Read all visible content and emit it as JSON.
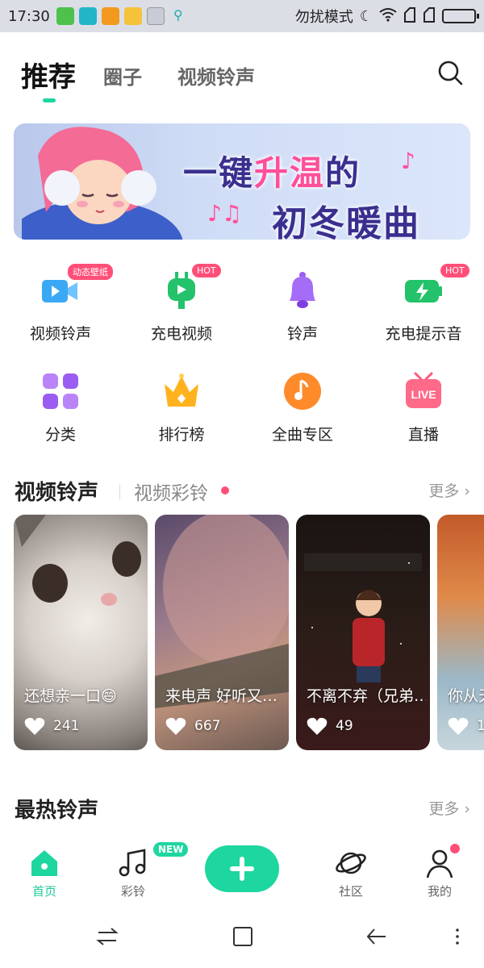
{
  "status_bar": {
    "time": "17:30",
    "dnd_text": "勿扰模式"
  },
  "top_tabs": [
    {
      "label": "推荐",
      "active": true
    },
    {
      "label": "圈子",
      "active": false
    },
    {
      "label": "视频铃声",
      "active": false
    }
  ],
  "banner": {
    "line1_a": "一键",
    "line1_pink": "升温",
    "line1_b": "的",
    "line2": "初冬暖曲"
  },
  "grid_items": [
    {
      "label": "视频铃声",
      "badge": "动态壁纸",
      "icon": "video-camera-icon",
      "color": "#2f9cf0"
    },
    {
      "label": "充电视频",
      "badge": "HOT",
      "icon": "charging-video-icon",
      "color": "#23c26b"
    },
    {
      "label": "铃声",
      "badge": "",
      "icon": "bell-icon",
      "color": "#9b5cf2"
    },
    {
      "label": "充电提示音",
      "badge": "HOT",
      "icon": "battery-bolt-icon",
      "color": "#23c26b"
    },
    {
      "label": "分类",
      "badge": "",
      "icon": "category-grid-icon",
      "color": "#a36cf5"
    },
    {
      "label": "排行榜",
      "badge": "",
      "icon": "crown-icon",
      "color": "#ffb21d"
    },
    {
      "label": "全曲专区",
      "badge": "",
      "icon": "music-disc-icon",
      "color": "#ff8a2a"
    },
    {
      "label": "直播",
      "badge": "",
      "icon": "live-tv-icon",
      "color": "#ff5a7a"
    }
  ],
  "video_section": {
    "title": "视频铃声",
    "subtitle": "视频彩铃",
    "more": "更多 ›"
  },
  "video_cards": [
    {
      "title": "还想亲一口😄",
      "likes": "241"
    },
    {
      "title": "来电声 好听又…",
      "likes": "667"
    },
    {
      "title": "不离不弃（兄弟…",
      "likes": "49"
    },
    {
      "title": "你从天…",
      "likes": "1…"
    }
  ],
  "hot_section": {
    "title": "最热铃声",
    "more": "更多 ›"
  },
  "bottom_nav": {
    "home": "首页",
    "ringtone": "彩铃",
    "ringtone_badge": "NEW",
    "community": "社区",
    "mine": "我的"
  }
}
